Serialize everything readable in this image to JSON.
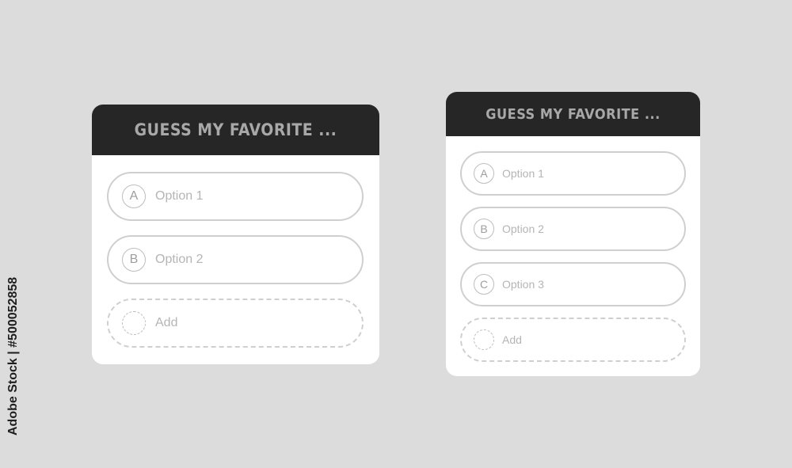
{
  "polls": [
    {
      "title": "GUESS MY FAVORITE ...",
      "options": [
        {
          "letter": "A",
          "label": "Option 1"
        },
        {
          "letter": "B",
          "label": "Option 2"
        }
      ],
      "add_label": "Add"
    },
    {
      "title": "GUESS MY FAVORITE ...",
      "options": [
        {
          "letter": "A",
          "label": "Option 1"
        },
        {
          "letter": "B",
          "label": "Option 2"
        },
        {
          "letter": "C",
          "label": "Option 3"
        }
      ],
      "add_label": "Add"
    }
  ],
  "watermark": "Adobe Stock | #500052858"
}
